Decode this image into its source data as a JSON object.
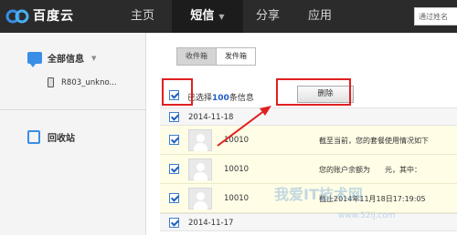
{
  "brand": {
    "logo_text": "百度云",
    "accent": "#3a8ee6"
  },
  "nav": {
    "home": "主页",
    "sms": "短信",
    "share": "分享",
    "app": "应用",
    "search_placeholder": "通过姓名"
  },
  "sidebar": {
    "all_messages": "全部信息",
    "device": "R803_unkno...",
    "recycle": "回收站"
  },
  "tabs": {
    "inbox": "收件箱",
    "outbox": "发件箱"
  },
  "toolbar": {
    "selected_prefix": "已选择",
    "selected_count": "100",
    "selected_suffix": "条信息",
    "delete_label": "删除"
  },
  "groups": [
    {
      "date": "2014-11-18",
      "messages": [
        {
          "sender": "10010",
          "preview": "截至当前，您的套餐使用情况如下"
        },
        {
          "sender": "10010",
          "preview": "您的账户余额为　　元，其中："
        },
        {
          "sender": "10010",
          "preview": "截止2014年11月18日17:19:05"
        }
      ]
    },
    {
      "date": "2014-11-17",
      "messages": []
    }
  ],
  "watermark": {
    "text": "我爱IT技术网",
    "url": "www.52ij.com"
  },
  "colors": {
    "highlight": "#e02020",
    "row_bg": "#fffde6",
    "topbar": "#2b2b2b"
  }
}
